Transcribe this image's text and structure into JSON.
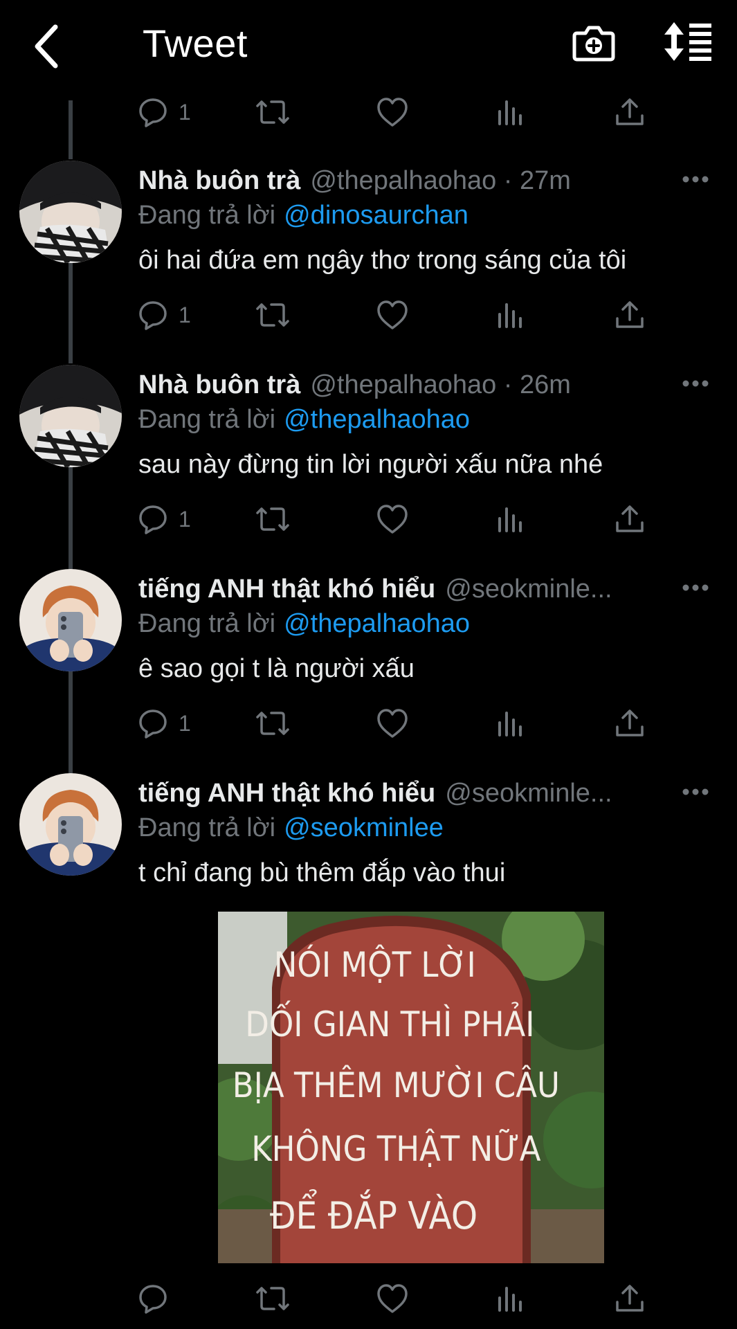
{
  "header": {
    "title": "Tweet",
    "back_icon": "chevron-left-icon",
    "camera_icon": "camera-plus-icon",
    "sort_icon": "sort-list-icon"
  },
  "top_actions": {
    "reply_count": "1"
  },
  "tweets": [
    {
      "name": "Nhà buôn trà",
      "handle": "@thepalhaohao · 27m",
      "reply_prefix": "Đang trả lời",
      "reply_to": "@dinosaurchan",
      "text": "ôi hai đứa em ngây thơ trong sáng của tôi",
      "reply_count": "1"
    },
    {
      "name": "Nhà buôn trà",
      "handle": "@thepalhaohao · 26m",
      "reply_prefix": "Đang trả lời",
      "reply_to": "@thepalhaohao",
      "text": "sau này đừng tin lời người xấu nữa nhé",
      "reply_count": "1"
    },
    {
      "name": "tiếng ANH thật khó hiểu",
      "handle": "@seokminle...",
      "reply_prefix": "Đang trả lời",
      "reply_to": "@thepalhaohao",
      "text": "ê sao gọi t là người xấu",
      "reply_count": "1"
    },
    {
      "name": "tiếng ANH thật khó hiểu",
      "handle": "@seokminle...",
      "reply_prefix": "Đang trả lời",
      "reply_to": "@seokminlee",
      "text": "t chỉ đang bù thêm đắp vào thui",
      "reply_count": "",
      "media": {
        "lines": [
          "NÓI MỘT LỜI",
          "DỐI GIAN THÌ PHẢI",
          "BỊA THÊM MƯỜI CÂU",
          "KHÔNG THẬT NỮA",
          "ĐỂ ĐẮP VÀO"
        ]
      }
    }
  ],
  "colors": {
    "background": "#000000",
    "text": "#e7e9ea",
    "secondary": "#71767b",
    "link": "#1d9bf0",
    "sign": "#a3453a"
  }
}
